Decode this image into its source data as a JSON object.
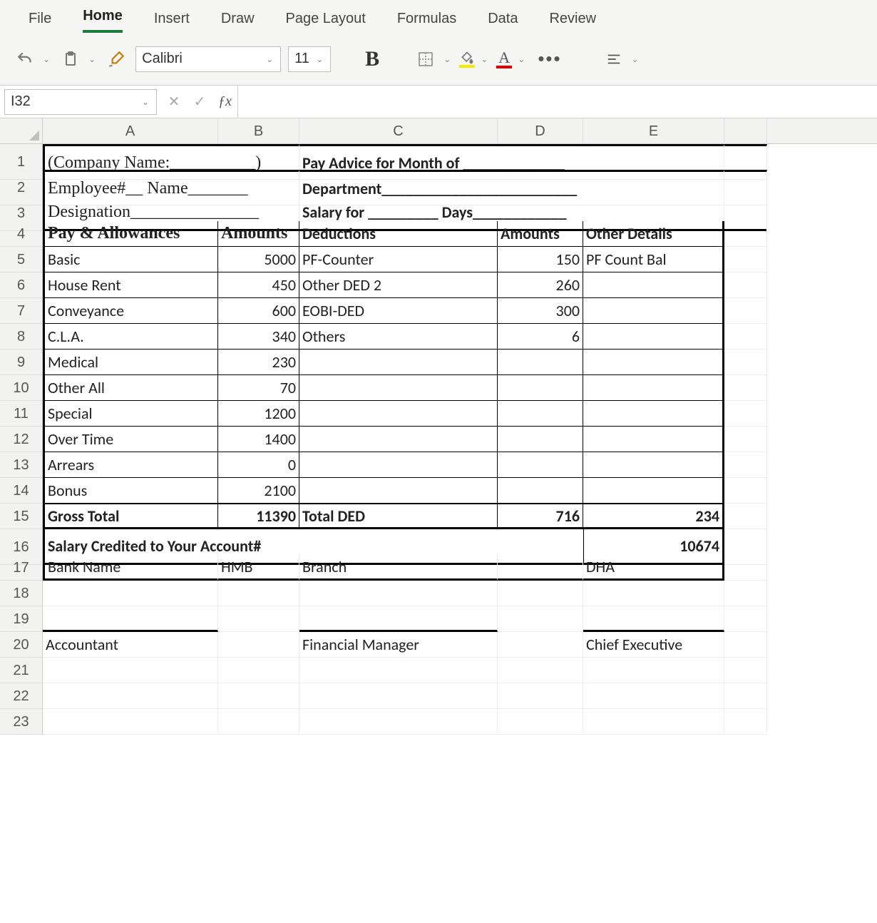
{
  "ribbon": {
    "tabs": [
      "File",
      "Home",
      "Insert",
      "Draw",
      "Page Layout",
      "Formulas",
      "Data",
      "Review"
    ],
    "active_tab": "Home",
    "font_name": "Calibri",
    "font_size": "11",
    "bold_label": "B"
  },
  "name_box": "I32",
  "columns": [
    "A",
    "B",
    "C",
    "D",
    "E",
    ""
  ],
  "rows": [
    "1",
    "2",
    "3",
    "4",
    "5",
    "6",
    "7",
    "8",
    "9",
    "10",
    "11",
    "12",
    "13",
    "14",
    "15",
    "16",
    "17",
    "18",
    "19",
    "20",
    "21",
    "22",
    "23"
  ],
  "doc": {
    "r1_a": "(Company Name:__________)",
    "r1_c": "Pay Advice for Month of _____________",
    "r2_a": "Employee#__   Name_______",
    "r2_c": "Department_________________________",
    "r3_a": "Designation_______________",
    "r3_c": "Salary for _________ Days____________",
    "hdr_pay": "Pay & Allowances",
    "hdr_amt1": "Amounts",
    "hdr_ded": "Deductions",
    "hdr_amt2": "Amounts",
    "hdr_other": "Other Details",
    "rows": [
      {
        "a": "Basic",
        "b": "5000",
        "c": "PF-Counter",
        "d": "150",
        "e": "PF Count Bal"
      },
      {
        "a": "House Rent",
        "b": "450",
        "c": "Other DED 2",
        "d": "260",
        "e": ""
      },
      {
        "a": "Conveyance",
        "b": "600",
        "c": "EOBI-DED",
        "d": "300",
        "e": ""
      },
      {
        "a": "C.L.A.",
        "b": "340",
        "c": "Others",
        "d": "6",
        "e": ""
      },
      {
        "a": "Medical",
        "b": "230",
        "c": "",
        "d": "",
        "e": ""
      },
      {
        "a": "Other All",
        "b": "70",
        "c": "",
        "d": "",
        "e": ""
      },
      {
        "a": "Special",
        "b": "1200",
        "c": "",
        "d": "",
        "e": ""
      },
      {
        "a": "Over Time",
        "b": "1400",
        "c": "",
        "d": "",
        "e": ""
      },
      {
        "a": "Arrears",
        "b": "0",
        "c": "",
        "d": "",
        "e": ""
      },
      {
        "a": "Bonus",
        "b": "2100",
        "c": "",
        "d": "",
        "e": ""
      }
    ],
    "gross_label": "Gross Total",
    "gross_val": "11390",
    "totded_label": "Total DED",
    "totded_val": "716",
    "other_total": "234",
    "credited_label": "Salary Credited to Your Account#",
    "credited_val": "10674",
    "bank_label": "Bank Name",
    "bank_val": "HMB",
    "branch_label": "Branch",
    "branch_val": "DHA",
    "sig1": "Accountant",
    "sig2": "Financial Manager",
    "sig3": "Chief Executive"
  }
}
